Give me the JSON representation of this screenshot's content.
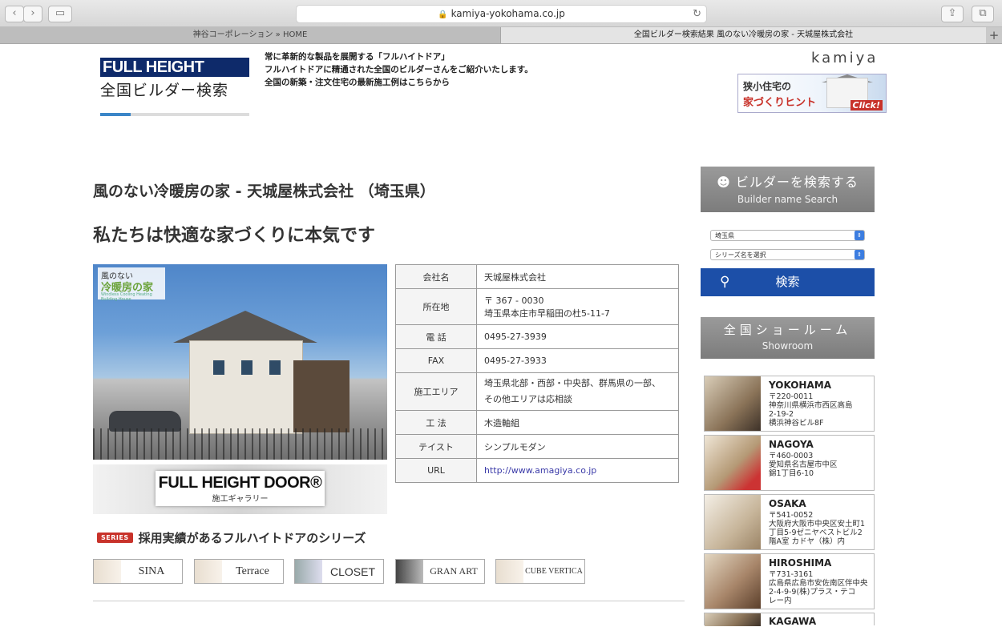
{
  "browser": {
    "url": "kamiya-yokohama.co.jp",
    "tabs": [
      {
        "label": "神谷コーポレーション » HOME"
      },
      {
        "label": "全国ビルダー検索結果 風のない冷暖房の家 - 天城屋株式会社"
      }
    ],
    "new_tab_label": "+"
  },
  "header": {
    "logo_line1": "FULL HEIGHT DOOR®",
    "logo_line2": "全国ビルダー検索",
    "tagline": [
      "常に革新的な製品を展開する「フルハイトドア」",
      "フルハイトドアに精通された全国のビルダーさんをご紹介いたします。",
      "全国の新築・注文住宅の最新施工例はこちらから"
    ],
    "brand": "kamiya",
    "banner": {
      "line1": "狭小住宅の",
      "line2": "家づくりヒント",
      "click": "Click!"
    }
  },
  "main": {
    "page_title": "風のない冷暖房の家 - 天城屋株式会社 （埼玉県）",
    "headline": "私たちは快適な家づくりに本気です",
    "photo_badge": {
      "line1": "風のない",
      "line2": "冷暖房の家",
      "line3": "Windless Cooling Heating Building House"
    },
    "gallery": {
      "title": "FULL HEIGHT DOOR®",
      "subtitle": "施工ギャラリー"
    },
    "series_tag": "SERIES",
    "series_title": "採用実績があるフルハイトドアのシリーズ",
    "series": [
      "SINA",
      "Terrace",
      "CLOSET",
      "GRAN ART",
      "CUBE VERTICA"
    ],
    "info": [
      {
        "key": "会社名",
        "value": "天城屋株式会社"
      },
      {
        "key": "所在地",
        "value": "〒 367 - 0030",
        "value2": "埼玉県本庄市早稲田の杜5-11-7"
      },
      {
        "key": "電 話",
        "value": "0495-27-3939"
      },
      {
        "key": "FAX",
        "value": "0495-27-3933"
      },
      {
        "key": "施工エリア",
        "value": "埼玉県北部・西部・中央部、群馬県の一部、",
        "value2": "その他エリアは応相談"
      },
      {
        "key": "工 法",
        "value": "木造軸組"
      },
      {
        "key": "テイスト",
        "value": "シンプルモダン"
      },
      {
        "key": "URL",
        "value": "http://www.amagiya.co.jp"
      }
    ]
  },
  "sidebar": {
    "search_head": {
      "jp": "ビルダーを検索する",
      "en": "Builder name Search"
    },
    "prefecture": "埼玉県",
    "series_select": "シリーズ名を選択",
    "search_button": "検索",
    "showroom_head": {
      "jp": "全国ショールーム",
      "en": "Showroom"
    },
    "showrooms": [
      {
        "name": "YOKOHAMA",
        "addr": "〒220-0011\n神奈川県横浜市西区高島\n2-19-2\n横浜神谷ビル8F"
      },
      {
        "name": "NAGOYA",
        "addr": "〒460-0003\n愛知県名古屋市中区\n錦1丁目6-10"
      },
      {
        "name": "OSAKA",
        "addr": "〒541-0052\n大阪府大阪市中央区安土町1\n丁目5-9ゼニヤベストビル2\n階A室 カドヤ（株）内"
      },
      {
        "name": "HIROSHIMA",
        "addr": "〒731-3161\n広島県広島市安佐南区伴中央\n2-4-9-9(株)プラス・テコ\nレー内"
      },
      {
        "name": "KAGAWA",
        "addr": ""
      }
    ]
  }
}
